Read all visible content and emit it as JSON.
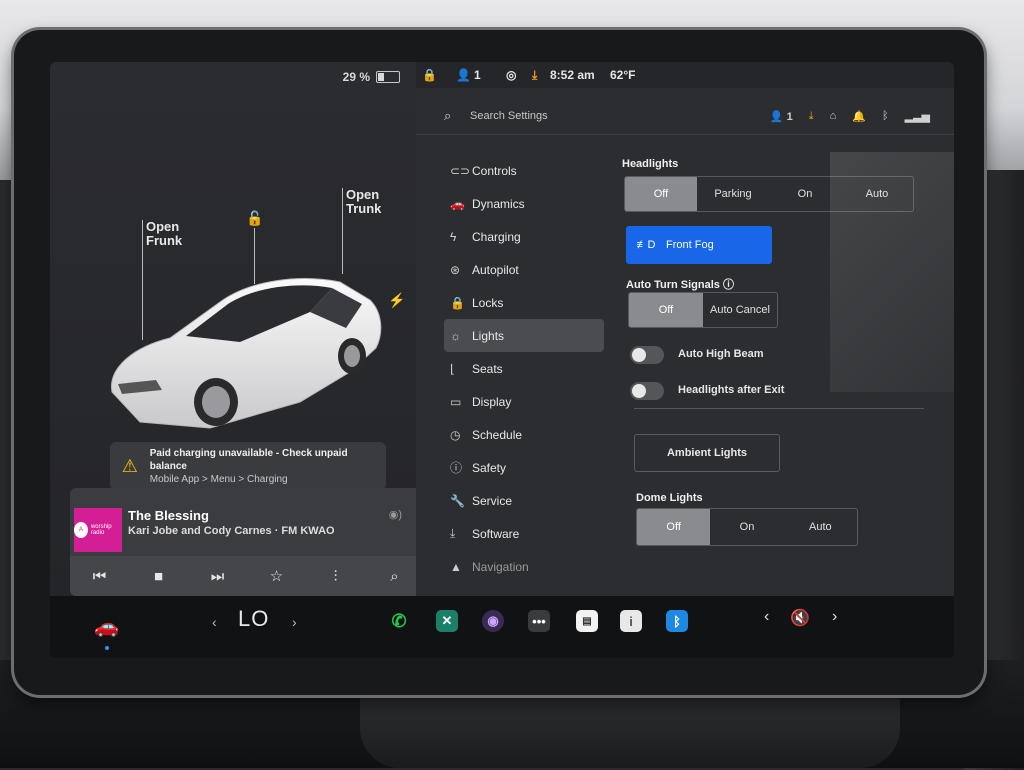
{
  "status": {
    "battery_percent": "29 %",
    "battery_level": 0.29,
    "profile_count": "1",
    "time": "8:52 am",
    "temperature": "62°F"
  },
  "car": {
    "open_frunk_label": "Open\nFrunk",
    "open_trunk_label": "Open\nTrunk",
    "car_color": "#f2f2f2"
  },
  "alert": {
    "icon": "warning-icon",
    "title": "Paid charging unavailable - Check unpaid balance",
    "subtitle": "Mobile App > Menu > Charging"
  },
  "media": {
    "song": "The Blessing",
    "artist": "Kari Jobe and Cody Carnes · FM KWAO",
    "album_text": "worship radio",
    "controls": [
      "previous-icon",
      "stop-icon",
      "next-icon",
      "favorite-icon",
      "equalizer-icon",
      "search-icon"
    ]
  },
  "dock": {
    "temperature": "LO",
    "left_arrow": "‹",
    "right_arrow": "›",
    "apps": [
      "phone-icon",
      "toybox-icon",
      "camera-icon",
      "more-icon",
      "calendar-icon",
      "manual-icon",
      "bluetooth-icon"
    ]
  },
  "settings": {
    "search_placeholder": "Search Settings",
    "profile_count": "1",
    "nav": [
      {
        "label": "Controls",
        "icon": "toggle-icon"
      },
      {
        "label": "Dynamics",
        "icon": "car-icon"
      },
      {
        "label": "Charging",
        "icon": "bolt-icon"
      },
      {
        "label": "Autopilot",
        "icon": "steering-wheel-icon"
      },
      {
        "label": "Locks",
        "icon": "lock-icon"
      },
      {
        "label": "Lights",
        "icon": "sun-icon"
      },
      {
        "label": "Seats",
        "icon": "seat-icon"
      },
      {
        "label": "Display",
        "icon": "display-icon"
      },
      {
        "label": "Schedule",
        "icon": "clock-icon"
      },
      {
        "label": "Safety",
        "icon": "info-icon"
      },
      {
        "label": "Service",
        "icon": "wrench-icon"
      },
      {
        "label": "Software",
        "icon": "download-icon"
      },
      {
        "label": "Navigation",
        "icon": "navigation-icon"
      }
    ],
    "active_nav": "Lights",
    "headlights": {
      "label": "Headlights",
      "options": [
        "Off",
        "Parking",
        "On",
        "Auto"
      ],
      "selected": "Off"
    },
    "front_fog": "Front Fog",
    "auto_turn_signals": {
      "label": "Auto Turn Signals",
      "options": [
        "Off",
        "Auto Cancel"
      ],
      "selected": "Off"
    },
    "auto_high_beam": "Auto High Beam",
    "headlights_after_exit": "Headlights after Exit",
    "ambient_lights": "Ambient Lights",
    "dome_lights": {
      "label": "Dome Lights",
      "options": [
        "Off",
        "On",
        "Auto"
      ],
      "selected": "Off"
    },
    "accent_blue": "#1767e8"
  }
}
